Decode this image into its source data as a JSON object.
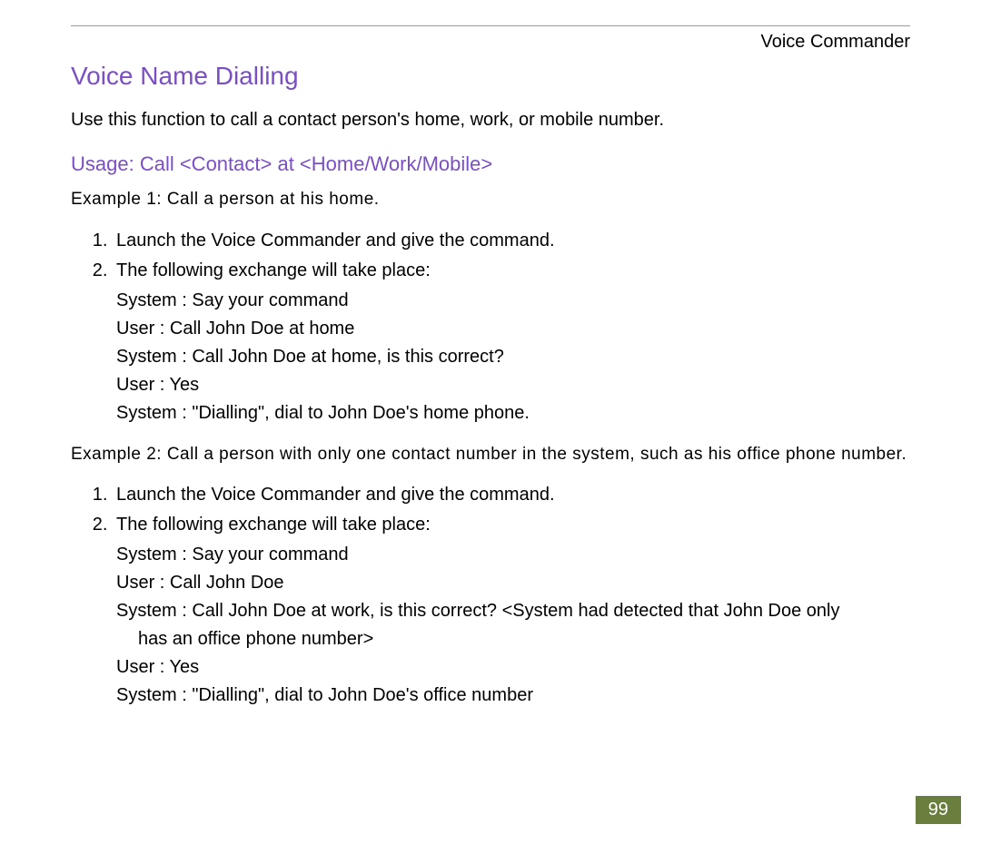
{
  "header": {
    "label": "Voice Commander"
  },
  "title": "Voice Name Dialling",
  "intro": "Use this function to call a contact person's home, work, or mobile number.",
  "usage": "Usage: Call <Contact> at <Home/Work/Mobile>",
  "example1": {
    "heading": "Example 1: Call a person at his home.",
    "step1": "Launch the Voice Commander and give the command.",
    "step2": "The following exchange will take place:",
    "d1": "System :  Say your command",
    "d2": "User :  Call John Doe at home",
    "d3": "System :  Call John Doe at home, is this correct?",
    "d4": "User :  Yes",
    "d5": "System :  \"Dialling\", dial to John Doe's home phone."
  },
  "example2": {
    "heading": "Example 2: Call a person with only one contact number in the system, such as his ofﬁce phone number.",
    "step1": "Launch the Voice Commander and give the command.",
    "step2": "The following exchange will take place:",
    "d1": "System :  Say your command",
    "d2": "User :  Call John Doe",
    "d3a": "System :  Call John Doe at work, is this correct?  <System had detected that John Doe only",
    "d3b": "has an office phone number>",
    "d4": "User :  Yes",
    "d5": "System :  \"Dialling\", dial to John Doe's office number"
  },
  "pageNumber": "99"
}
